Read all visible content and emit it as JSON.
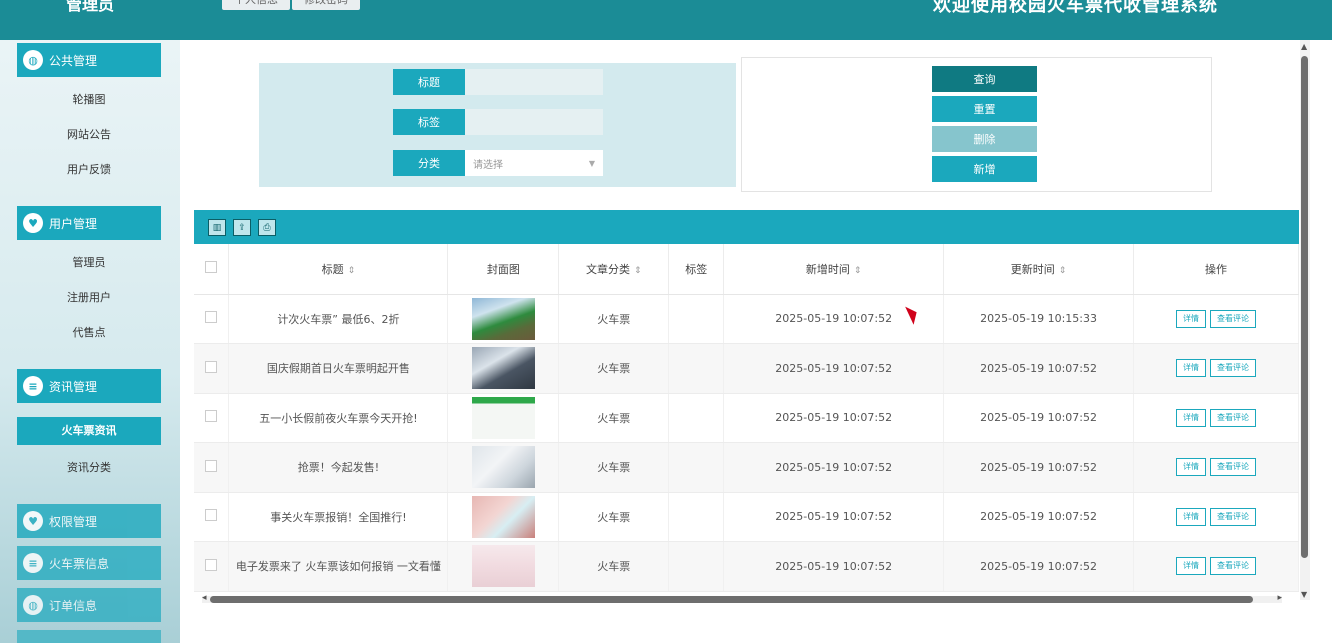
{
  "header": {
    "role": "管理员",
    "tabs": [
      "个人信息",
      "修改密码"
    ],
    "site_title": "欢迎使用校园火车票代收管理系统"
  },
  "sidebar": {
    "groups": [
      {
        "title": "公共管理",
        "icon": "globe-icon",
        "items": [
          "轮播图",
          "网站公告",
          "用户反馈"
        ]
      },
      {
        "title": "用户管理",
        "icon": "heart-icon",
        "items": [
          "管理员",
          "注册用户",
          "代售点"
        ]
      },
      {
        "title": "资讯管理",
        "icon": "list-icon",
        "items": [
          "火车票资讯",
          "资讯分类"
        ],
        "active": "火车票资讯"
      },
      {
        "title": "权限管理",
        "icon": "heart-icon",
        "items": []
      },
      {
        "title": "火车票信息",
        "icon": "list-icon",
        "items": []
      },
      {
        "title": "订单信息",
        "icon": "globe-icon",
        "items": []
      }
    ]
  },
  "search": {
    "title_label": "标题",
    "tag_label": "标签",
    "category_label": "分类",
    "category_placeholder": "请选择"
  },
  "actions": {
    "query": "查询",
    "reset": "重置",
    "delete": "删除",
    "add": "新增"
  },
  "toolbar": {
    "icons": [
      "columns-icon",
      "export-icon",
      "print-icon"
    ]
  },
  "table": {
    "columns": [
      "标题",
      "封面图",
      "文章分类",
      "标签",
      "新增时间",
      "更新时间",
      "操作"
    ],
    "op_detail": "详情",
    "op_comments": "查看评论",
    "rows": [
      {
        "title": "计次火车票” 最低6、2折",
        "category": "火车票",
        "tag": "",
        "created": "2025-05-19 10:07:52",
        "updated": "2025-05-19 10:15:33"
      },
      {
        "title": "国庆假期首日火车票明起开售",
        "category": "火车票",
        "tag": "",
        "created": "2025-05-19 10:07:52",
        "updated": "2025-05-19 10:07:52"
      },
      {
        "title": "五一小长假前夜火车票今天开抢!",
        "category": "火车票",
        "tag": "",
        "created": "2025-05-19 10:07:52",
        "updated": "2025-05-19 10:07:52"
      },
      {
        "title": "抢票！今起发售!",
        "category": "火车票",
        "tag": "",
        "created": "2025-05-19 10:07:52",
        "updated": "2025-05-19 10:07:52"
      },
      {
        "title": "事关火车票报销！全国推行!",
        "category": "火车票",
        "tag": "",
        "created": "2025-05-19 10:07:52",
        "updated": "2025-05-19 10:07:52"
      },
      {
        "title": "电子发票来了 火车票该如何报销 一文看懂",
        "category": "火车票",
        "tag": "",
        "created": "2025-05-19 10:07:52",
        "updated": "2025-05-19 10:07:52"
      }
    ]
  },
  "colors": {
    "header": "#1b8c96",
    "accent": "#1ba8bd",
    "query_button": "#0f7a82",
    "delete_button": "#86c5cd",
    "search_panel": "#d3eaee"
  }
}
